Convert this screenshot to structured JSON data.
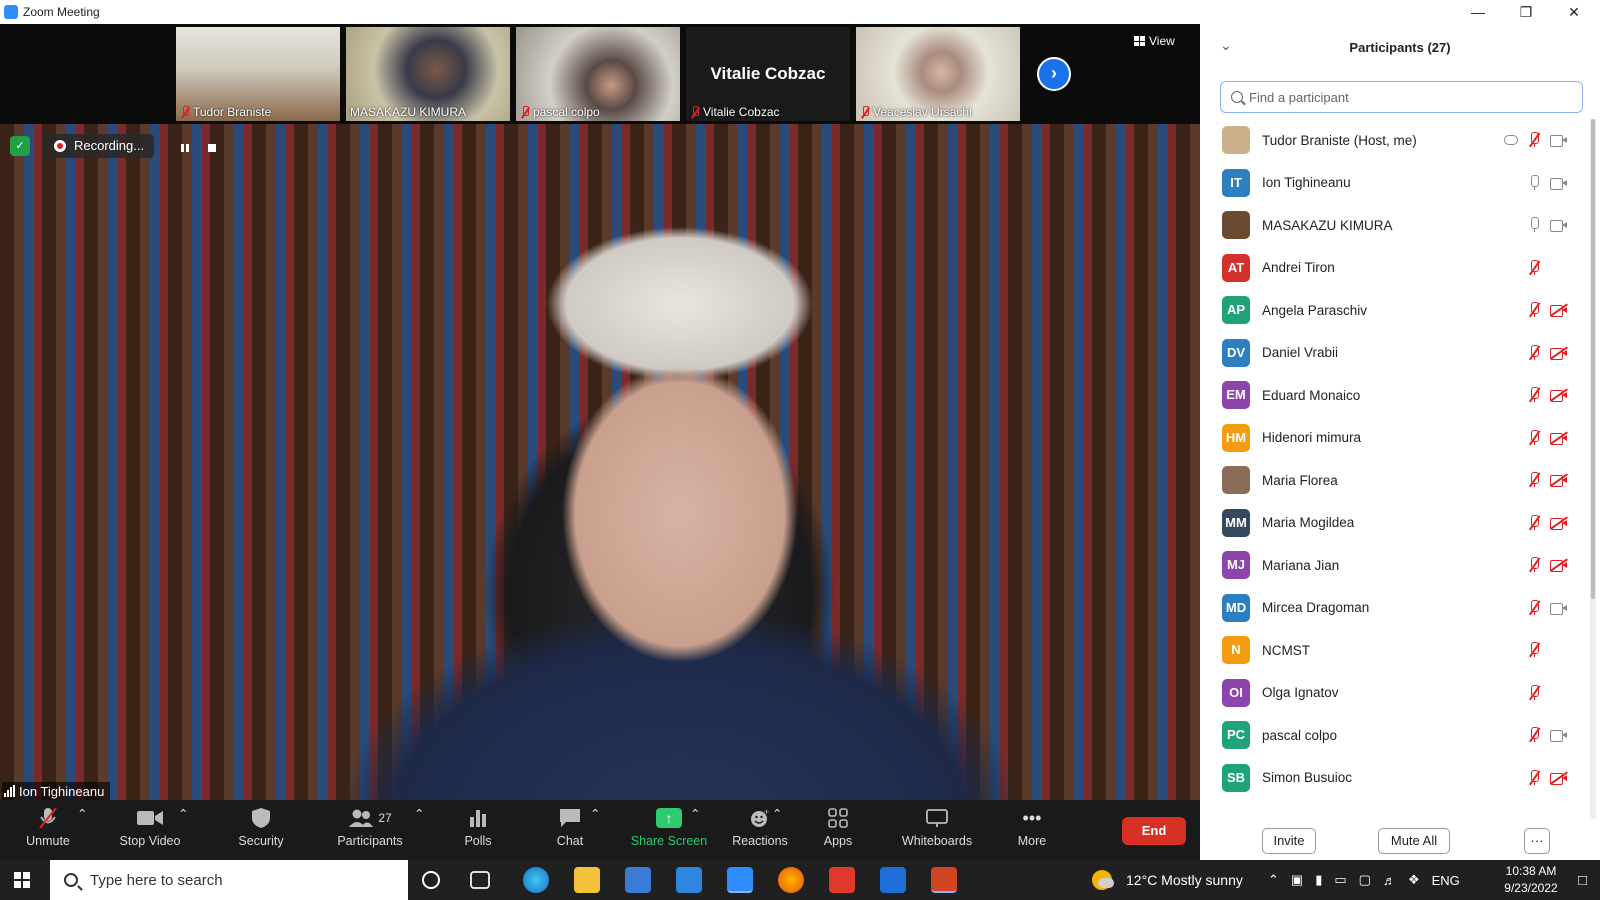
{
  "window": {
    "title": "Zoom Meeting"
  },
  "thumbnails": [
    {
      "name": "Tudor Braniste",
      "muted": true
    },
    {
      "name": "MASAKAZU KIMURA",
      "muted": false
    },
    {
      "name": "pascal colpo",
      "muted": true
    },
    {
      "name": "Vitalie Cobzac",
      "muted": true,
      "display_name": "Vitalie Cobzac"
    },
    {
      "name": "Veaceslav Ursachi",
      "muted": true
    }
  ],
  "view_label": "View",
  "recording": {
    "label": "Recording..."
  },
  "main_speaker": {
    "name": "Ion Tighineanu"
  },
  "toolbar": {
    "unmute": "Unmute",
    "stop_video": "Stop Video",
    "security": "Security",
    "participants": "Participants",
    "participants_count": "27",
    "polls": "Polls",
    "chat": "Chat",
    "share_screen": "Share Screen",
    "reactions": "Reactions",
    "apps": "Apps",
    "whiteboards": "Whiteboards",
    "more": "More",
    "end": "End"
  },
  "panel": {
    "title": "Participants (27)",
    "search_placeholder": "Find a participant",
    "invite": "Invite",
    "mute_all": "Mute All",
    "more": "···",
    "participants": [
      {
        "name": "Tudor Braniste (Host, me)",
        "initials": "",
        "color": "#c9b08a",
        "mic": "off",
        "cam": "on",
        "cloud": true
      },
      {
        "name": "Ion Tighineanu",
        "initials": "IT",
        "color": "#2d7fc1",
        "mic": "on",
        "cam": "on"
      },
      {
        "name": "MASAKAZU KIMURA",
        "initials": "",
        "color": "#6b4a32",
        "mic": "on",
        "cam": "on"
      },
      {
        "name": "Andrei Tiron",
        "initials": "AT",
        "color": "#d2322d",
        "mic": "off",
        "cam": "none"
      },
      {
        "name": "Angela Paraschiv",
        "initials": "AP",
        "color": "#1fa37a",
        "mic": "off",
        "cam": "off"
      },
      {
        "name": "Daniel Vrabii",
        "initials": "DV",
        "color": "#2d7fc1",
        "mic": "off",
        "cam": "off"
      },
      {
        "name": "Eduard Monaico",
        "initials": "EM",
        "color": "#8e44ad",
        "mic": "off",
        "cam": "off"
      },
      {
        "name": "Hidenori mimura",
        "initials": "HM",
        "color": "#f39c12",
        "mic": "off",
        "cam": "off"
      },
      {
        "name": "Maria Florea",
        "initials": "",
        "color": "#8a6c59",
        "mic": "off",
        "cam": "off"
      },
      {
        "name": "Maria Mogildea",
        "initials": "MM",
        "color": "#34495e",
        "mic": "off",
        "cam": "off"
      },
      {
        "name": "Mariana Jian",
        "initials": "MJ",
        "color": "#8e44ad",
        "mic": "off",
        "cam": "off"
      },
      {
        "name": "Mircea Dragoman",
        "initials": "MD",
        "color": "#2d7fc1",
        "mic": "off",
        "cam": "on"
      },
      {
        "name": "NCMST",
        "initials": "N",
        "color": "#f39c12",
        "mic": "off",
        "cam": "none"
      },
      {
        "name": "Olga Ignatov",
        "initials": "OI",
        "color": "#8e44ad",
        "mic": "off",
        "cam": "none"
      },
      {
        "name": "pascal colpo",
        "initials": "PC",
        "color": "#1fa37a",
        "mic": "off",
        "cam": "on"
      },
      {
        "name": "Simon Busuioc",
        "initials": "SB",
        "color": "#1fa37a",
        "mic": "off",
        "cam": "off"
      }
    ]
  },
  "taskbar": {
    "search_placeholder": "Type here to search",
    "weather": "12°C  Mostly sunny",
    "language": "ENG",
    "time": "10:38 AM",
    "date": "9/23/2022"
  },
  "colors": {
    "accent": "#2d8cff",
    "end_red": "#d93025",
    "share_green": "#2ecc71"
  }
}
